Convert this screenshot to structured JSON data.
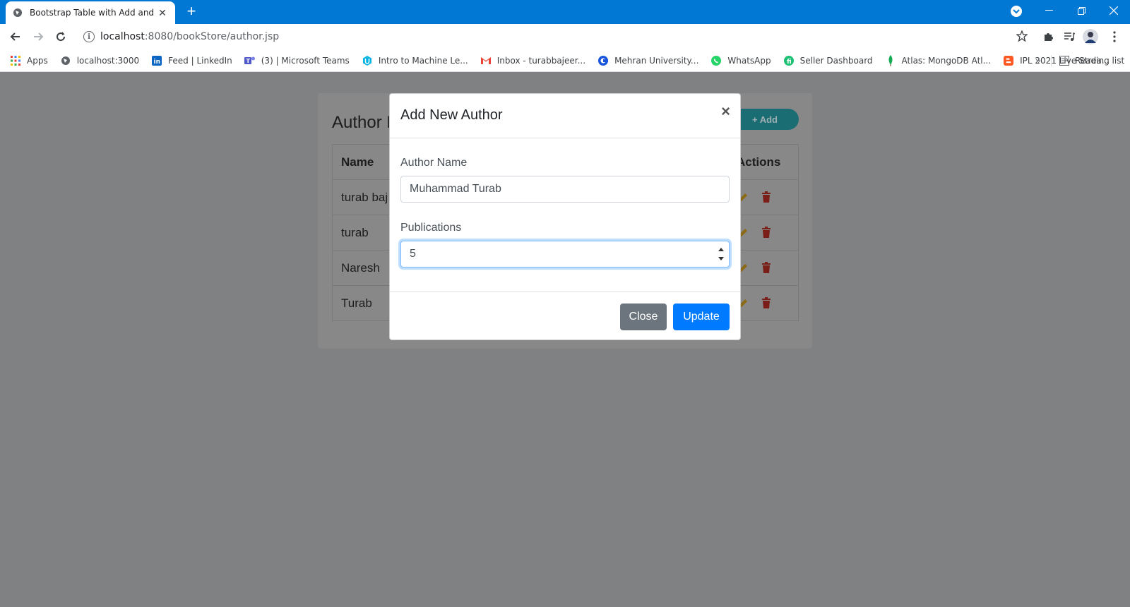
{
  "browser": {
    "tab_title": "Bootstrap Table with Add and Delete",
    "url_host": "localhost",
    "url_rest": ":8080/bookStore/author.jsp",
    "bookmarks": [
      {
        "label": "Apps",
        "icon": "apps-grid-icon"
      },
      {
        "label": "localhost:3000",
        "icon": "globe-icon"
      },
      {
        "label": "Feed | LinkedIn",
        "icon": "linkedin-icon"
      },
      {
        "label": "(3) | Microsoft Teams",
        "icon": "teams-icon"
      },
      {
        "label": "Intro to Machine Le...",
        "icon": "udacity-icon"
      },
      {
        "label": "Inbox - turabbajeer...",
        "icon": "gmail-icon"
      },
      {
        "label": "Mehran University...",
        "icon": "mehran-icon"
      },
      {
        "label": "WhatsApp",
        "icon": "whatsapp-icon"
      },
      {
        "label": "Seller Dashboard",
        "icon": "fiverr-icon"
      },
      {
        "label": "Atlas: MongoDB Atl...",
        "icon": "mongodb-icon"
      },
      {
        "label": "IPL 2021 Live Strea...",
        "icon": "blogger-icon"
      }
    ],
    "reading_list": "Reading list"
  },
  "page": {
    "card_title": "Author M",
    "add_label": "+ Add",
    "table": {
      "headers": [
        "Name",
        "Actions"
      ],
      "rows": [
        "turab baj",
        "turab",
        "Naresh",
        "Turab"
      ]
    }
  },
  "modal": {
    "title": "Add New Author",
    "close_glyph": "×",
    "author_name_label": "Author Name",
    "author_name_value": "Muhammad Turab",
    "publications_label": "Publications",
    "publications_value": "5",
    "close_button": "Close",
    "update_button": "Update"
  },
  "colors": {
    "chrome_blue": "#0078d4",
    "primary": "#007bff",
    "secondary": "#6c757d",
    "backdrop": "#808183"
  }
}
